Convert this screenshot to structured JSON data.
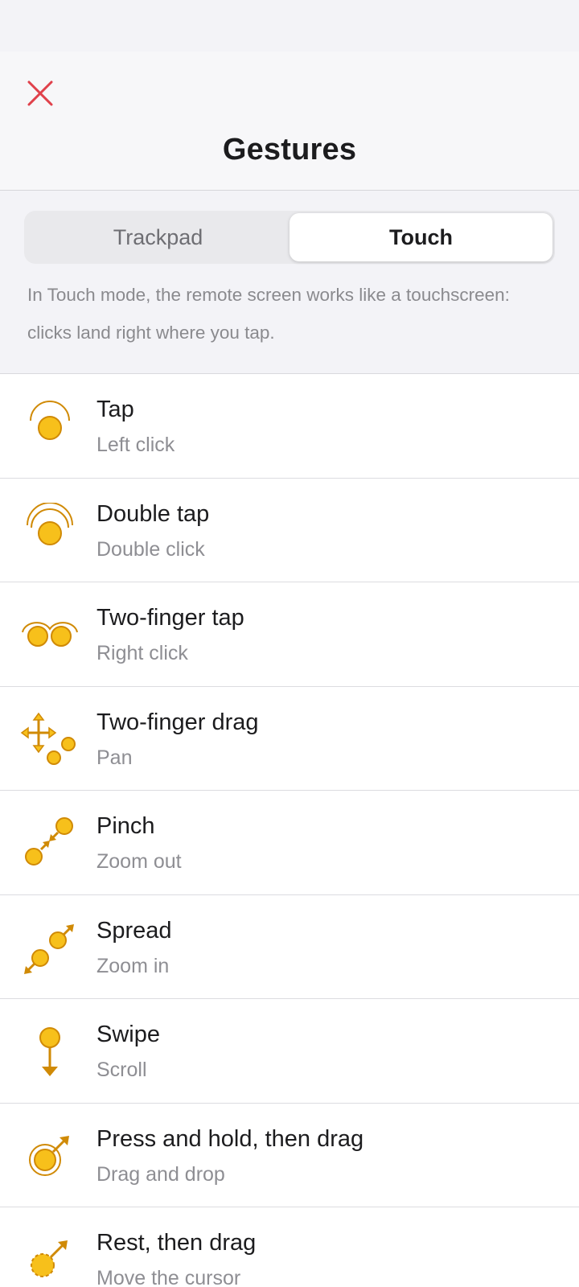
{
  "header": {
    "title": "Gestures",
    "close_icon": "close-icon",
    "close_color": "#e0414b"
  },
  "mode_switch": {
    "options": [
      "Trackpad",
      "Touch"
    ],
    "selected": "Touch"
  },
  "description": "In Touch mode, the remote screen works like a touchscreen: clicks land right where you tap.",
  "accent_color": "#f7c01b",
  "accent_dark": "#d08a06",
  "gestures": [
    {
      "name": "Tap",
      "action": "Left click",
      "icon": "tap-icon"
    },
    {
      "name": "Double tap",
      "action": "Double click",
      "icon": "double-tap-icon"
    },
    {
      "name": "Two-finger tap",
      "action": "Right click",
      "icon": "two-finger-tap-icon"
    },
    {
      "name": "Two-finger drag",
      "action": "Pan",
      "icon": "two-finger-drag-icon"
    },
    {
      "name": "Pinch",
      "action": "Zoom out",
      "icon": "pinch-icon"
    },
    {
      "name": "Spread",
      "action": "Zoom in",
      "icon": "spread-icon"
    },
    {
      "name": "Swipe",
      "action": "Scroll",
      "icon": "swipe-icon"
    },
    {
      "name": "Press and hold, then drag",
      "action": "Drag and drop",
      "icon": "press-hold-drag-icon"
    },
    {
      "name": "Rest, then drag",
      "action": "Move the cursor",
      "icon": "rest-drag-icon"
    }
  ]
}
